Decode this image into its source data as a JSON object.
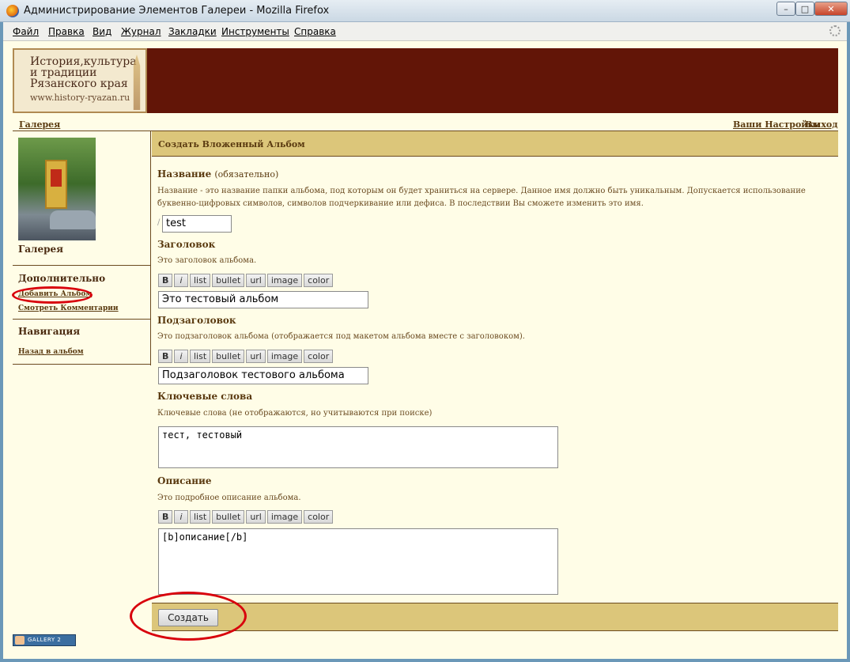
{
  "window": {
    "title": "Администрирование Элементов Галереи - Mozilla Firefox",
    "min_label": "–",
    "max_label": "□",
    "close_label": "✕"
  },
  "menubar": {
    "items": [
      "Файл",
      "Правка",
      "Вид",
      "Журнал",
      "Закладки",
      "Инструменты",
      "Справка"
    ]
  },
  "logo": {
    "text": "История,культура\nи традиции\nРязанского края",
    "url": "www.history-ryazan.ru"
  },
  "topnav": {
    "gallery": "Галерея",
    "settings": "Ваши Настройки",
    "logout": "Выход"
  },
  "sidebar": {
    "photo_caption": "Галерея",
    "extra_title": "Дополнительно",
    "add_album": "Добавить Альбом",
    "view_comments": "Смотреть Комментарии",
    "nav_title": "Навигация",
    "back_to_album": "Назад в альбом"
  },
  "form": {
    "header": "Создать Вложенный Альбом",
    "name": {
      "label": "Название",
      "required": "(обязательно)",
      "desc": "Название - это название папки альбома, под которым он будет храниться на сервере. Данное имя должно быть уникальным. Допускается использование буквенно-цифровых символов, символов подчеркивание или дефиса. В последствии Вы сможете изменить это имя.",
      "prefix": "/",
      "value": "test"
    },
    "title": {
      "label": "Заголовок",
      "desc": "Это заголовок альбома.",
      "value": "Это тестовый альбом"
    },
    "subtitle": {
      "label": "Подзаголовок",
      "desc": "Это подзаголовок альбома (отображается под макетом альбома вместе с заголовоком).",
      "value": "Подзаголовок тестового альбома"
    },
    "keywords": {
      "label": "Ключевые слова",
      "desc": "Ключевые слова (не отображаются, но учитываются при поиске)",
      "value": "тест, тестовый"
    },
    "description": {
      "label": "Описание",
      "desc": "Это подробное описание альбома.",
      "value": "[b]описание[/b]"
    },
    "toolbar": [
      "B",
      "i",
      "list",
      "bullet",
      "url",
      "image",
      "color"
    ],
    "submit": "Создать"
  },
  "footer": {
    "badge": "GALLERY 2"
  },
  "annotation_color": "#d8000c"
}
